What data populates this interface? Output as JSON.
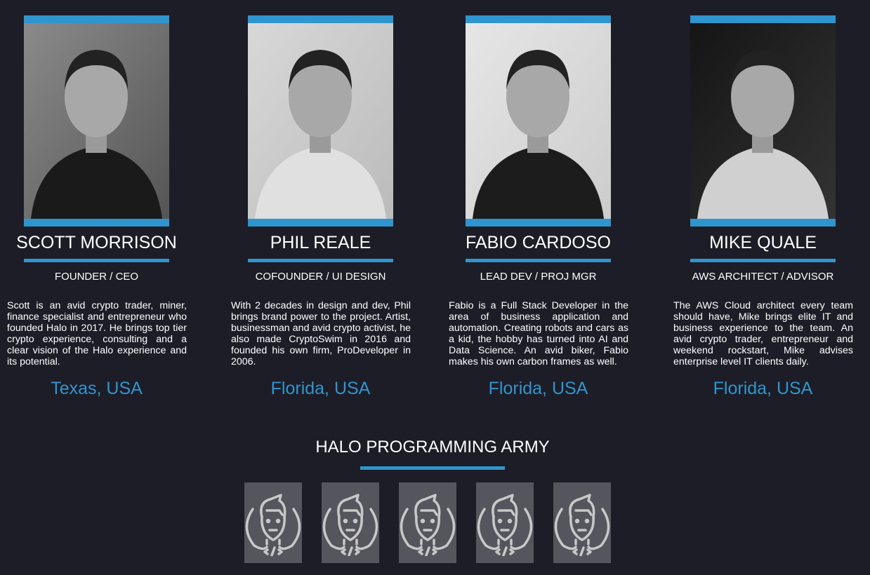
{
  "team": [
    {
      "name": "SCOTT MORRISON",
      "role": "FOUNDER / CEO",
      "bio": "Scott is an avid crypto trader, miner, finance specialist and entrepreneur who founded Halo in 2017. He brings top tier crypto experience, consulting and a clear vision of the Halo experience and its potential.",
      "location": "Texas, USA"
    },
    {
      "name": "PHIL REALE",
      "role": "COFOUNDER / UI DESIGN",
      "bio": "With 2 decades in design and dev, Phil brings brand power to the project. Artist, businessman and avid crypto activist, he also made CryptoSwim in 2016 and founded his own firm, ProDeveloper in 2006.",
      "location": "Florida, USA"
    },
    {
      "name": "FABIO CARDOSO",
      "role": "LEAD DEV / PROJ MGR",
      "bio": "Fabio is a Full Stack Developer in the area of business application and automation. Creating robots and cars as a kid, the hobby has turned into AI and Data Science. An avid biker, Fabio makes his own carbon frames as well.",
      "location": "Florida, USA"
    },
    {
      "name": "MIKE QUALE",
      "role": "AWS ARCHITECT / ADVISOR",
      "bio": "The AWS Cloud architect every team should have, Mike brings elite IT and business experience  to the team. An avid crypto trader, entrepreneur and weekend rockstart, Mike advises enterprise level IT clients daily.",
      "location": "Florida, USA"
    }
  ],
  "army": {
    "title": "HALO PROGRAMMING ARMY",
    "count": 5
  },
  "colors": {
    "accent": "#2f95cf",
    "background": "#1d1d27",
    "tile": "#55555d"
  }
}
